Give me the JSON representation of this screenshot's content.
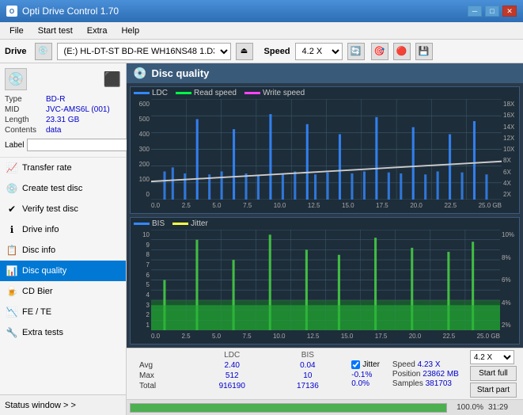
{
  "titlebar": {
    "title": "Opti Drive Control 1.70",
    "min_label": "─",
    "max_label": "□",
    "close_label": "✕"
  },
  "menubar": {
    "items": [
      "File",
      "Start test",
      "Extra",
      "Help"
    ]
  },
  "drivebar": {
    "drive_label": "Drive",
    "drive_value": "(E:) HL-DT-ST BD-RE  WH16NS48 1.D3",
    "speed_label": "Speed",
    "speed_value": "4.2 X"
  },
  "disc": {
    "type_label": "Type",
    "type_value": "BD-R",
    "mid_label": "MID",
    "mid_value": "JVC-AMS6L (001)",
    "length_label": "Length",
    "length_value": "23.31 GB",
    "contents_label": "Contents",
    "contents_value": "data",
    "label_label": "Label"
  },
  "nav": {
    "items": [
      {
        "id": "transfer-rate",
        "label": "Transfer rate",
        "icon": "📈"
      },
      {
        "id": "create-test-disc",
        "label": "Create test disc",
        "icon": "💿"
      },
      {
        "id": "verify-test-disc",
        "label": "Verify test disc",
        "icon": "✔"
      },
      {
        "id": "drive-info",
        "label": "Drive info",
        "icon": "ℹ"
      },
      {
        "id": "disc-info",
        "label": "Disc info",
        "icon": "📋"
      },
      {
        "id": "disc-quality",
        "label": "Disc quality",
        "icon": "📊",
        "active": true
      },
      {
        "id": "cd-bier",
        "label": "CD Bier",
        "icon": "🍺"
      },
      {
        "id": "fe-te",
        "label": "FE / TE",
        "icon": "📉"
      },
      {
        "id": "extra-tests",
        "label": "Extra tests",
        "icon": "🔧"
      }
    ],
    "status_window": "Status window > >"
  },
  "chart": {
    "title": "Disc quality",
    "legend_top": {
      "ldc": "LDC",
      "read_speed": "Read speed",
      "write_speed": "Write speed"
    },
    "legend_bottom": {
      "bis": "BIS",
      "jitter": "Jitter"
    },
    "top_y_left": [
      "600",
      "500",
      "400",
      "300",
      "200",
      "100",
      "0"
    ],
    "top_y_right": [
      "18X",
      "16X",
      "14X",
      "12X",
      "10X",
      "8X",
      "6X",
      "4X",
      "2X"
    ],
    "bottom_y_left": [
      "10",
      "9",
      "8",
      "7",
      "6",
      "5",
      "4",
      "3",
      "2",
      "1"
    ],
    "bottom_y_right": [
      "10%",
      "8%",
      "6%",
      "4%",
      "2%"
    ],
    "x_labels": [
      "0.0",
      "2.5",
      "5.0",
      "7.5",
      "10.0",
      "12.5",
      "15.0",
      "17.5",
      "20.0",
      "22.5",
      "25.0"
    ],
    "x_unit": "GB"
  },
  "stats": {
    "headers": [
      "LDC",
      "BIS",
      "",
      "Jitter",
      "Speed",
      ""
    ],
    "avg_label": "Avg",
    "avg_ldc": "2.40",
    "avg_bis": "0.04",
    "avg_jitter": "-0.1%",
    "max_label": "Max",
    "max_ldc": "512",
    "max_bis": "10",
    "max_jitter": "0.0%",
    "total_label": "Total",
    "total_ldc": "916190",
    "total_bis": "17136",
    "speed_label": "Speed",
    "speed_value": "4.23 X",
    "position_label": "Position",
    "position_value": "23862 MB",
    "samples_label": "Samples",
    "samples_value": "381703",
    "speed_select": "4.2 X",
    "btn_start_full": "Start full",
    "btn_start_part": "Start part",
    "jitter_checked": true,
    "jitter_label": "Jitter"
  },
  "progress": {
    "percent": 100,
    "percent_text": "100.0%",
    "time": "31:29"
  }
}
